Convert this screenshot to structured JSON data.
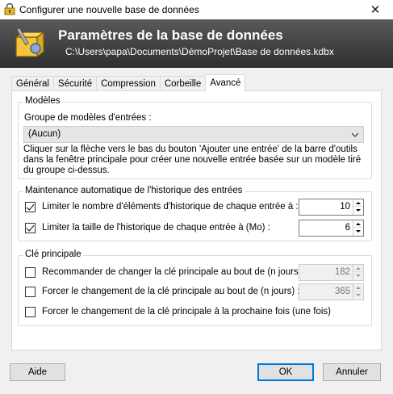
{
  "window": {
    "title": "Configurer une nouvelle base de données",
    "close_glyph": "✕"
  },
  "banner": {
    "title": "Paramètres de la base de données",
    "path": "C:\\Users\\papa\\Documents\\DémoProjet\\Base de données.kdbx"
  },
  "tabs": [
    {
      "label": "Général",
      "active": false
    },
    {
      "label": "Sécurité",
      "active": false
    },
    {
      "label": "Compression",
      "active": false
    },
    {
      "label": "Corbeille",
      "active": false
    },
    {
      "label": "Avancé",
      "active": true
    }
  ],
  "templates": {
    "group_title": "Modèles",
    "combo_label": "Groupe de modèles d'entrées :",
    "combo_value": "(Aucun)",
    "description": "Cliquer sur la flèche vers le bas du bouton 'Ajouter une entrée' de la barre d'outils dans la fenêtre principale pour créer une nouvelle entrée basée sur un modèle tiré du groupe ci-dessus."
  },
  "history": {
    "group_title": "Maintenance automatique de l'historique des entrées",
    "limit_count_label": "Limiter le nombre d'éléments d'historique de chaque entrée à :",
    "limit_count_checked": true,
    "limit_count_value": "10",
    "limit_size_label": "Limiter la taille de l'historique de chaque entrée à (Mo) :",
    "limit_size_checked": true,
    "limit_size_value": "6"
  },
  "master_key": {
    "group_title": "Clé principale",
    "recommend_label": "Recommander de changer la clé principale au bout de (n jours) :",
    "recommend_checked": false,
    "recommend_value": "182",
    "force_label": "Forcer le changement de la clé principale au bout de (n jours) :",
    "force_checked": false,
    "force_value": "365",
    "force_once_label": "Forcer le changement de la clé principale à la prochaine fois (une fois)",
    "force_once_checked": false
  },
  "buttons": {
    "help": "Aide",
    "ok": "OK",
    "cancel": "Annuler"
  }
}
